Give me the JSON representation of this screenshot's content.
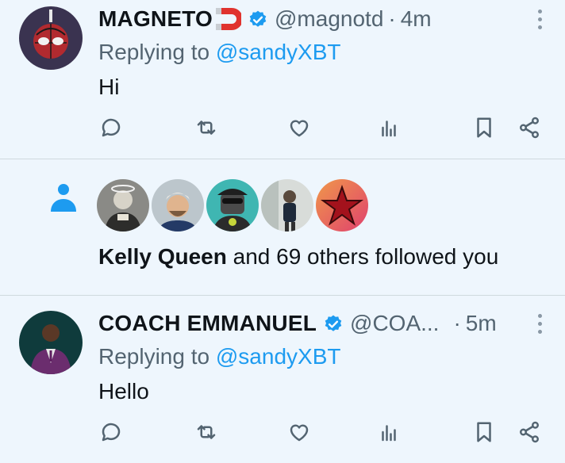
{
  "colors": {
    "background": "#eef6fd",
    "link": "#1d9bf0",
    "muted": "#536471",
    "verified": "#1d9bf0"
  },
  "posts": [
    {
      "name": "MAGNETO",
      "emoji_icon": "magnet-icon",
      "handle": "@magnotd",
      "separator": "·",
      "time": "4m",
      "replying_prefix": "Replying to ",
      "replying_to": "@sandyXBT",
      "text": "Hi"
    },
    {
      "name": "COACH EMMANUEL",
      "handle": "@COA...",
      "separator": "·",
      "time": "5m",
      "replying_prefix": "Replying to ",
      "replying_to": "@sandyXBT",
      "text": "Hello"
    }
  ],
  "follow_notification": {
    "icon": "person-icon",
    "name": "Kelly Queen",
    "rest": " and 69 others followed you",
    "avatar_count": 5
  },
  "action_icons": [
    "reply-icon",
    "repost-icon",
    "like-icon",
    "views-icon",
    "bookmark-icon",
    "share-icon"
  ]
}
